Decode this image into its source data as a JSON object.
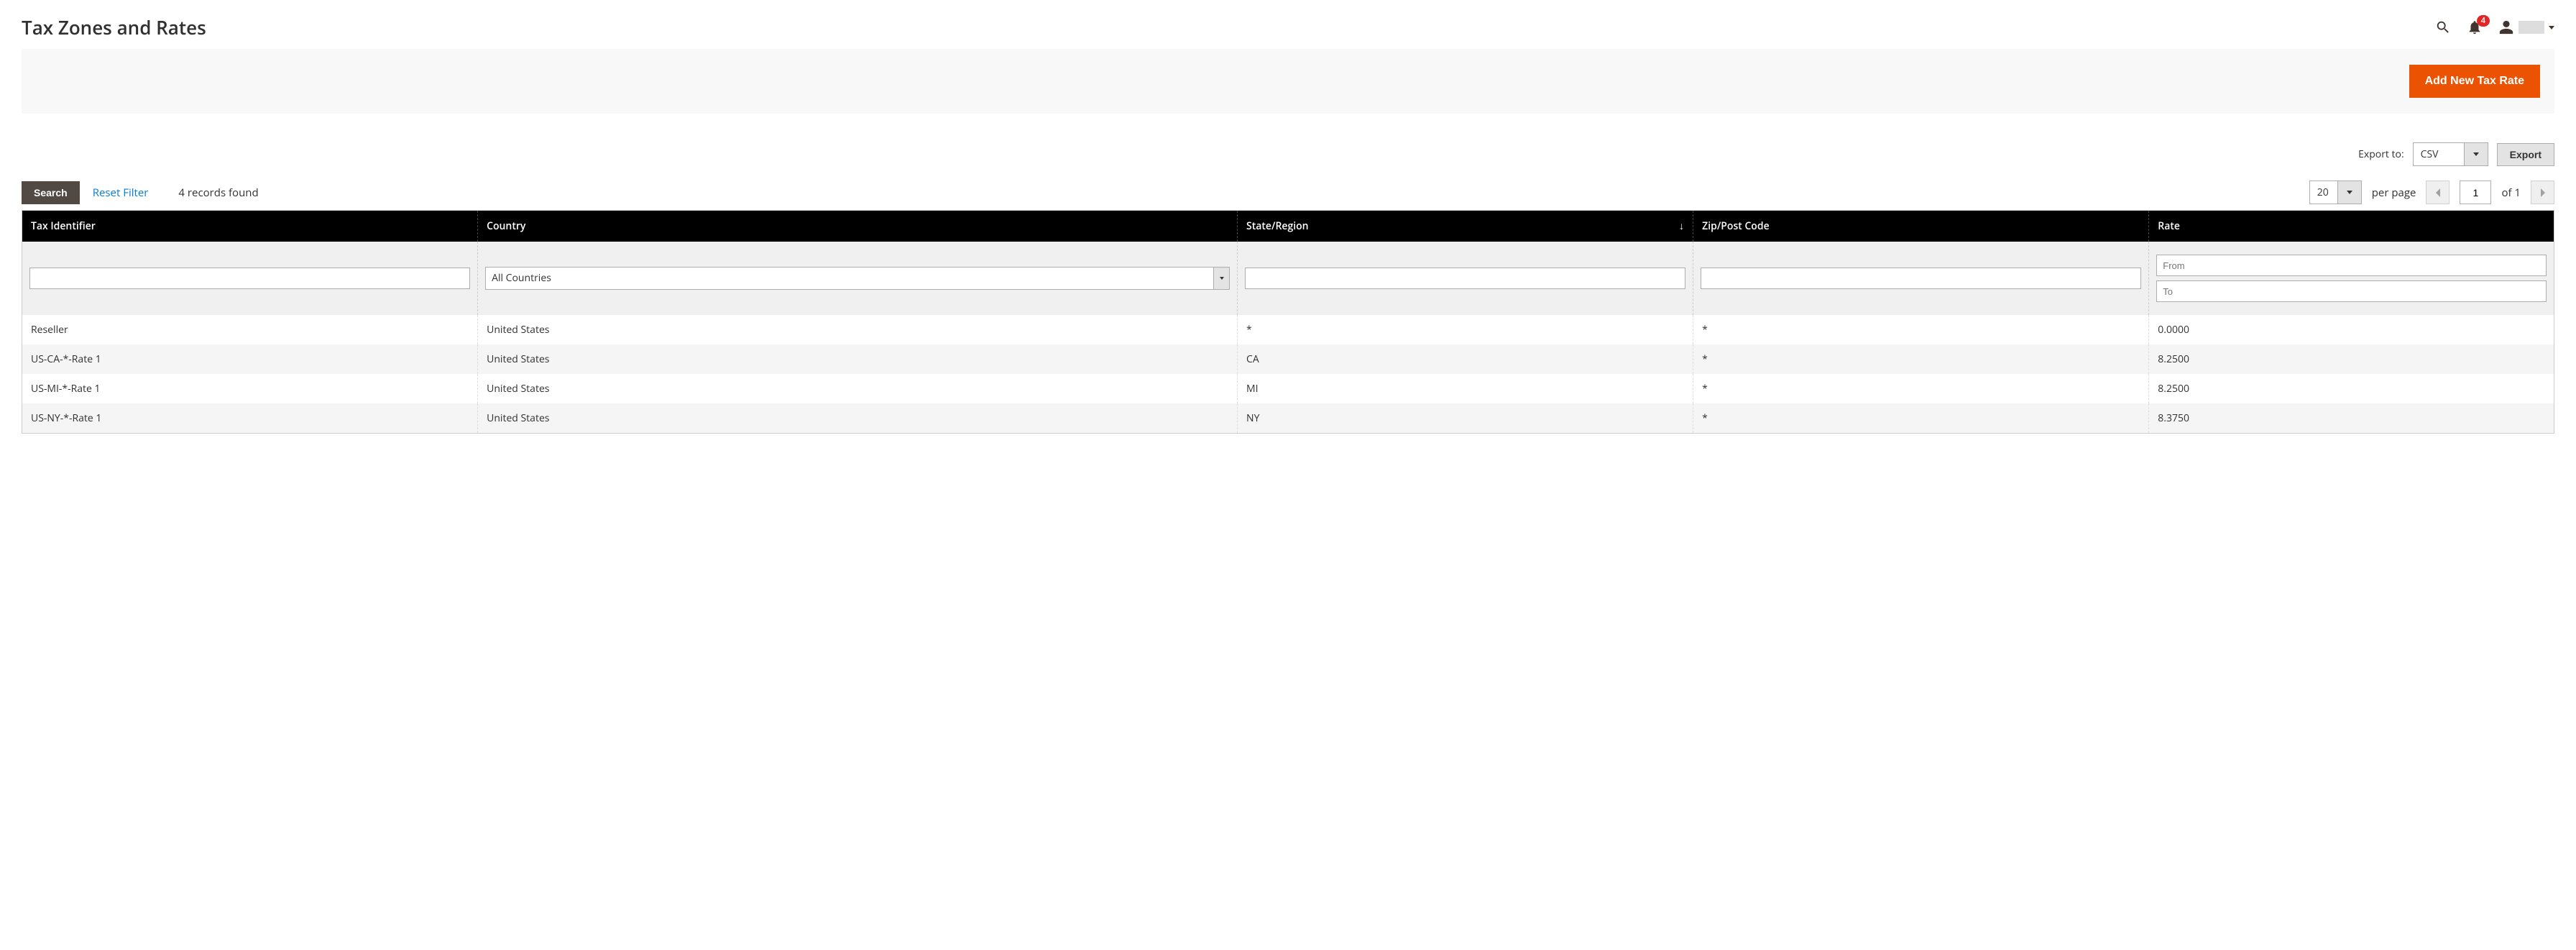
{
  "page_title": "Tax Zones and Rates",
  "header": {
    "notification_count": "4"
  },
  "action_bar": {
    "add_button": "Add New Tax Rate"
  },
  "export": {
    "label": "Export to:",
    "format": "CSV",
    "button": "Export"
  },
  "grid_controls": {
    "search_button": "Search",
    "reset_filter": "Reset Filter",
    "records_found": "4 records found",
    "per_page_value": "20",
    "per_page_label": "per page",
    "page_current": "1",
    "page_of_label": "of 1"
  },
  "columns": {
    "tax_identifier": "Tax Identifier",
    "country": "Country",
    "state_region": "State/Region",
    "zip_post": "Zip/Post Code",
    "rate": "Rate",
    "sort_indicator": "↓"
  },
  "filters": {
    "country_value": "All Countries",
    "rate_from_ph": "From",
    "rate_to_ph": "To"
  },
  "rows": [
    {
      "identifier": "Reseller",
      "country": "United States",
      "state": "*",
      "zip": "*",
      "rate": "0.0000"
    },
    {
      "identifier": "US-CA-*-Rate 1",
      "country": "United States",
      "state": "CA",
      "zip": "*",
      "rate": "8.2500"
    },
    {
      "identifier": "US-MI-*-Rate 1",
      "country": "United States",
      "state": "MI",
      "zip": "*",
      "rate": "8.2500"
    },
    {
      "identifier": "US-NY-*-Rate 1",
      "country": "United States",
      "state": "NY",
      "zip": "*",
      "rate": "8.3750"
    }
  ]
}
